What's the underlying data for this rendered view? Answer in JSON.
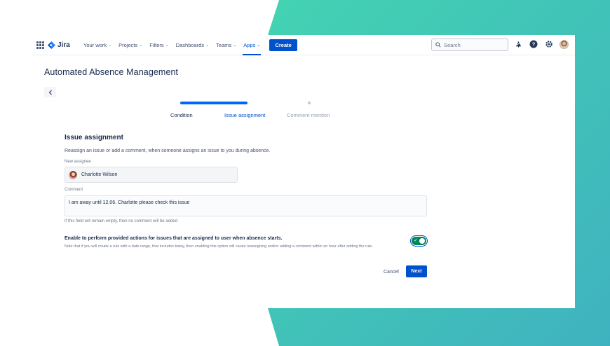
{
  "nav": {
    "logo_text": "Jira",
    "items": [
      {
        "label": "Your work"
      },
      {
        "label": "Projects"
      },
      {
        "label": "Filters"
      },
      {
        "label": "Dashboards"
      },
      {
        "label": "Teams"
      },
      {
        "label": "Apps"
      }
    ],
    "active_item": "Apps",
    "create_label": "Create",
    "search_placeholder": "Search"
  },
  "page": {
    "title": "Automated Absence Management"
  },
  "stepper": {
    "steps": [
      {
        "label": "Condition",
        "state": "done"
      },
      {
        "label": "Issue assignment",
        "state": "current"
      },
      {
        "label": "Comment mention",
        "state": "upcoming"
      }
    ]
  },
  "form": {
    "title": "Issue assignment",
    "description": "Reassign an issue or add a comment, when someone assigns an issue to you during absence.",
    "assignee_label": "New assignee",
    "assignee_name": "Charlotte Wilson",
    "comment_label": "Comment",
    "comment_value": "I am away until 12.06. Charlotte please check this issue",
    "comment_help": "If this field will remain empty, then no comment will be added",
    "enable_title": "Enable to perform provided actions for issues that are assigned to user when absence starts.",
    "enable_note": "Note that if you will create a rule with a date range, that includes today, then enabling this option will cause reassigning and/or adding a comment within an hour after adding the rule.",
    "enable_on": true,
    "cancel_label": "Cancel",
    "next_label": "Next"
  },
  "colors": {
    "brand": "#0052cc",
    "toggle_on": "#00875a",
    "teal": "#3ccbb0"
  },
  "icons": [
    "apps-grid-icon",
    "jira-logo-icon",
    "search-icon",
    "notification-icon",
    "help-icon",
    "settings-icon",
    "chevron-left-icon",
    "check-icon"
  ]
}
